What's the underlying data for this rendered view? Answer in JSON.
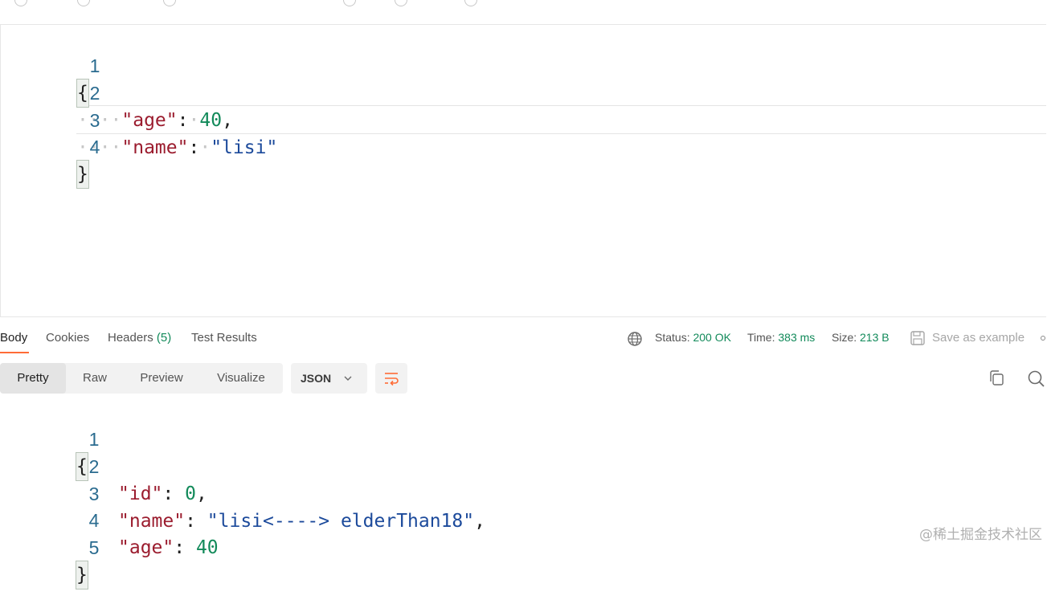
{
  "request_body": {
    "lines": [
      {
        "num": "1",
        "brace": "{"
      },
      {
        "num": "2",
        "indent": "····",
        "key": "\"age\"",
        "sep": ":",
        "sp": "·",
        "value": "40",
        "trail": ","
      },
      {
        "num": "3",
        "indent": "····",
        "key": "\"name\"",
        "sep": ":",
        "sp": "·",
        "value": "\"lisi\"",
        "trail": ""
      },
      {
        "num": "4",
        "brace": "}"
      }
    ]
  },
  "response_tabs": {
    "body": "Body",
    "cookies": "Cookies",
    "headers_label": "Headers",
    "headers_count": "(5)",
    "test_results": "Test Results"
  },
  "response_status": {
    "status_label": "Status:",
    "status_value": "200 OK",
    "time_label": "Time:",
    "time_value": "383 ms",
    "size_label": "Size:",
    "size_value": "213 B",
    "save_example": "Save as example"
  },
  "view_modes": {
    "pretty": "Pretty",
    "raw": "Raw",
    "preview": "Preview",
    "visualize": "Visualize",
    "format": "JSON"
  },
  "response_body": {
    "lines": [
      {
        "num": "1",
        "brace": "{"
      },
      {
        "num": "2",
        "key": "\"id\"",
        "sep": ": ",
        "value": "0",
        "trail": ","
      },
      {
        "num": "3",
        "key": "\"name\"",
        "sep": ": ",
        "value": "\"lisi<----> elderThan18\"",
        "trail": ","
      },
      {
        "num": "4",
        "key": "\"age\"",
        "sep": ": ",
        "value": "40",
        "trail": ""
      },
      {
        "num": "5",
        "brace": "}"
      }
    ]
  },
  "watermark": "@稀土掘金技术社区",
  "colors": {
    "accent": "#ff6c37",
    "key": "#9b1c2e",
    "string": "#1c4a9b",
    "number": "#128a5a",
    "line_number": "#2a6b8f"
  }
}
